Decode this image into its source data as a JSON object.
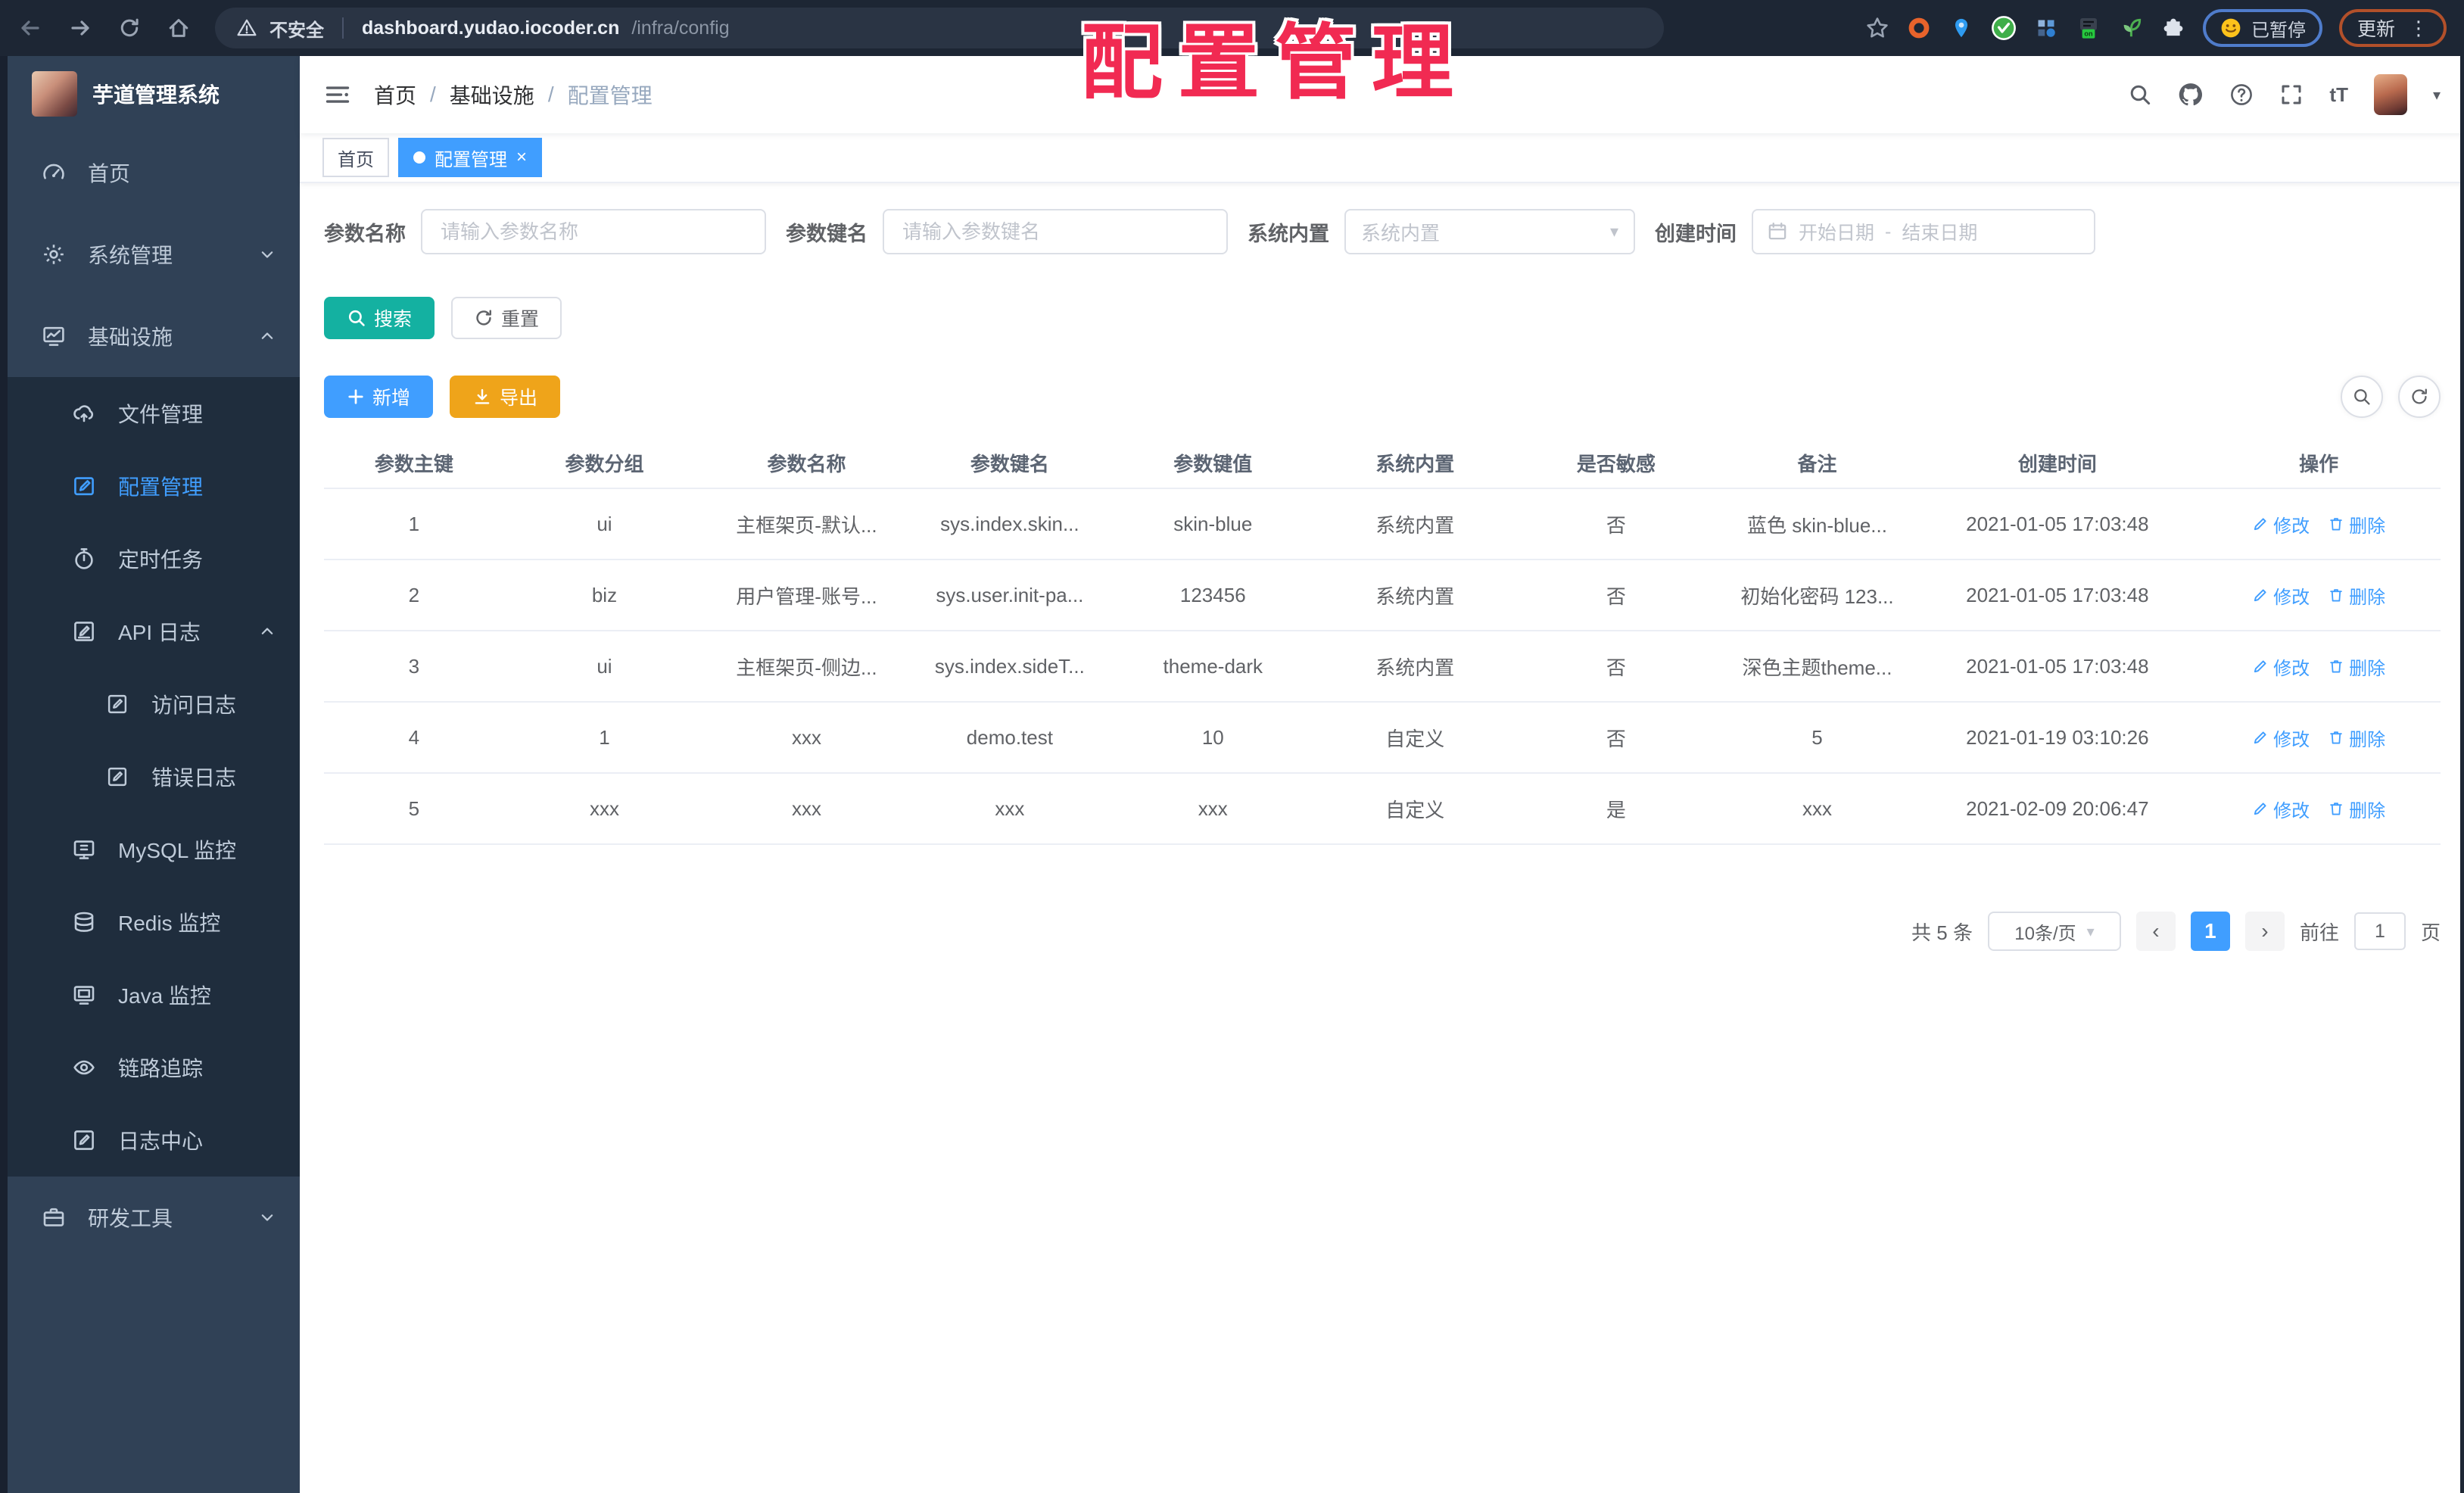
{
  "browser": {
    "security_label": "不安全",
    "url_host": "dashboard.yudao.iocoder.cn",
    "url_path": "/infra/config",
    "paused_label": "已暂停",
    "update_label": "更新"
  },
  "watermark": "配置管理",
  "sidebar": {
    "title": "芋道管理系统",
    "items": [
      {
        "label": "首页",
        "icon": "dashboard-icon"
      },
      {
        "label": "系统管理",
        "icon": "gear-icon",
        "expandable": "down"
      },
      {
        "label": "基础设施",
        "icon": "monitor-chart-icon",
        "expandable": "up"
      },
      {
        "label": "文件管理",
        "icon": "cloud-upload-icon"
      },
      {
        "label": "配置管理",
        "icon": "edit-square-icon",
        "active": true
      },
      {
        "label": "定时任务",
        "icon": "timer-icon"
      },
      {
        "label": "API 日志",
        "icon": "doc-edit-icon",
        "expandable": "up"
      },
      {
        "label": "访问日志",
        "icon": "doc-edit-icon"
      },
      {
        "label": "错误日志",
        "icon": "doc-edit-icon"
      },
      {
        "label": "MySQL 监控",
        "icon": "screen-icon"
      },
      {
        "label": "Redis 监控",
        "icon": "database-icon"
      },
      {
        "label": "Java 监控",
        "icon": "screen-icon"
      },
      {
        "label": "链路追踪",
        "icon": "eye-icon"
      },
      {
        "label": "日志中心",
        "icon": "doc-edit-icon"
      },
      {
        "label": "研发工具",
        "icon": "briefcase-icon",
        "expandable": "down"
      }
    ]
  },
  "header": {
    "breadcrumb": [
      "首页",
      "基础设施",
      "配置管理"
    ],
    "separator": "/"
  },
  "tabs": [
    {
      "label": "首页"
    },
    {
      "label": "配置管理",
      "active": true,
      "close": "×"
    }
  ],
  "filters": {
    "name_label": "参数名称",
    "name_placeholder": "请输入参数名称",
    "key_label": "参数键名",
    "key_placeholder": "请输入参数键名",
    "type_label": "系统内置",
    "type_placeholder": "系统内置",
    "date_label": "创建时间",
    "date_start_placeholder": "开始日期",
    "date_separator": "-",
    "date_end_placeholder": "结束日期"
  },
  "toolbar": {
    "search_label": "搜索",
    "reset_label": "重置",
    "add_label": "新增",
    "export_label": "导出"
  },
  "table": {
    "headers": [
      "参数主键",
      "参数分组",
      "参数名称",
      "参数键名",
      "参数键值",
      "系统内置",
      "是否敏感",
      "备注",
      "创建时间",
      "操作"
    ],
    "edit_label": "修改",
    "delete_label": "删除",
    "rows": [
      {
        "id": "1",
        "group": "ui",
        "name": "主框架页-默认...",
        "key": "sys.index.skin...",
        "value": "skin-blue",
        "type": "系统内置",
        "sensitive": "否",
        "remark": "蓝色 skin-blue...",
        "created_at": "2021-01-05 17:03:48"
      },
      {
        "id": "2",
        "group": "biz",
        "name": "用户管理-账号...",
        "key": "sys.user.init-pa...",
        "value": "123456",
        "type": "系统内置",
        "sensitive": "否",
        "remark": "初始化密码 123...",
        "created_at": "2021-01-05 17:03:48"
      },
      {
        "id": "3",
        "group": "ui",
        "name": "主框架页-侧边...",
        "key": "sys.index.sideT...",
        "value": "theme-dark",
        "type": "系统内置",
        "sensitive": "否",
        "remark": "深色主题theme...",
        "created_at": "2021-01-05 17:03:48"
      },
      {
        "id": "4",
        "group": "1",
        "name": "xxx",
        "key": "demo.test",
        "value": "10",
        "type": "自定义",
        "sensitive": "否",
        "remark": "5",
        "created_at": "2021-01-19 03:10:26"
      },
      {
        "id": "5",
        "group": "xxx",
        "name": "xxx",
        "key": "xxx",
        "value": "xxx",
        "type": "自定义",
        "sensitive": "是",
        "remark": "xxx",
        "created_at": "2021-02-09 20:06:47"
      }
    ]
  },
  "pagination": {
    "total": "共 5 条",
    "page_size": "10条/页",
    "prev": "‹",
    "current_page": "1",
    "next": "›",
    "goto_label": "前往",
    "goto_value": "1",
    "page_unit": "页"
  },
  "icons": {
    "caret_down": "▾",
    "kebab": "⋮",
    "text_size": "tT"
  }
}
